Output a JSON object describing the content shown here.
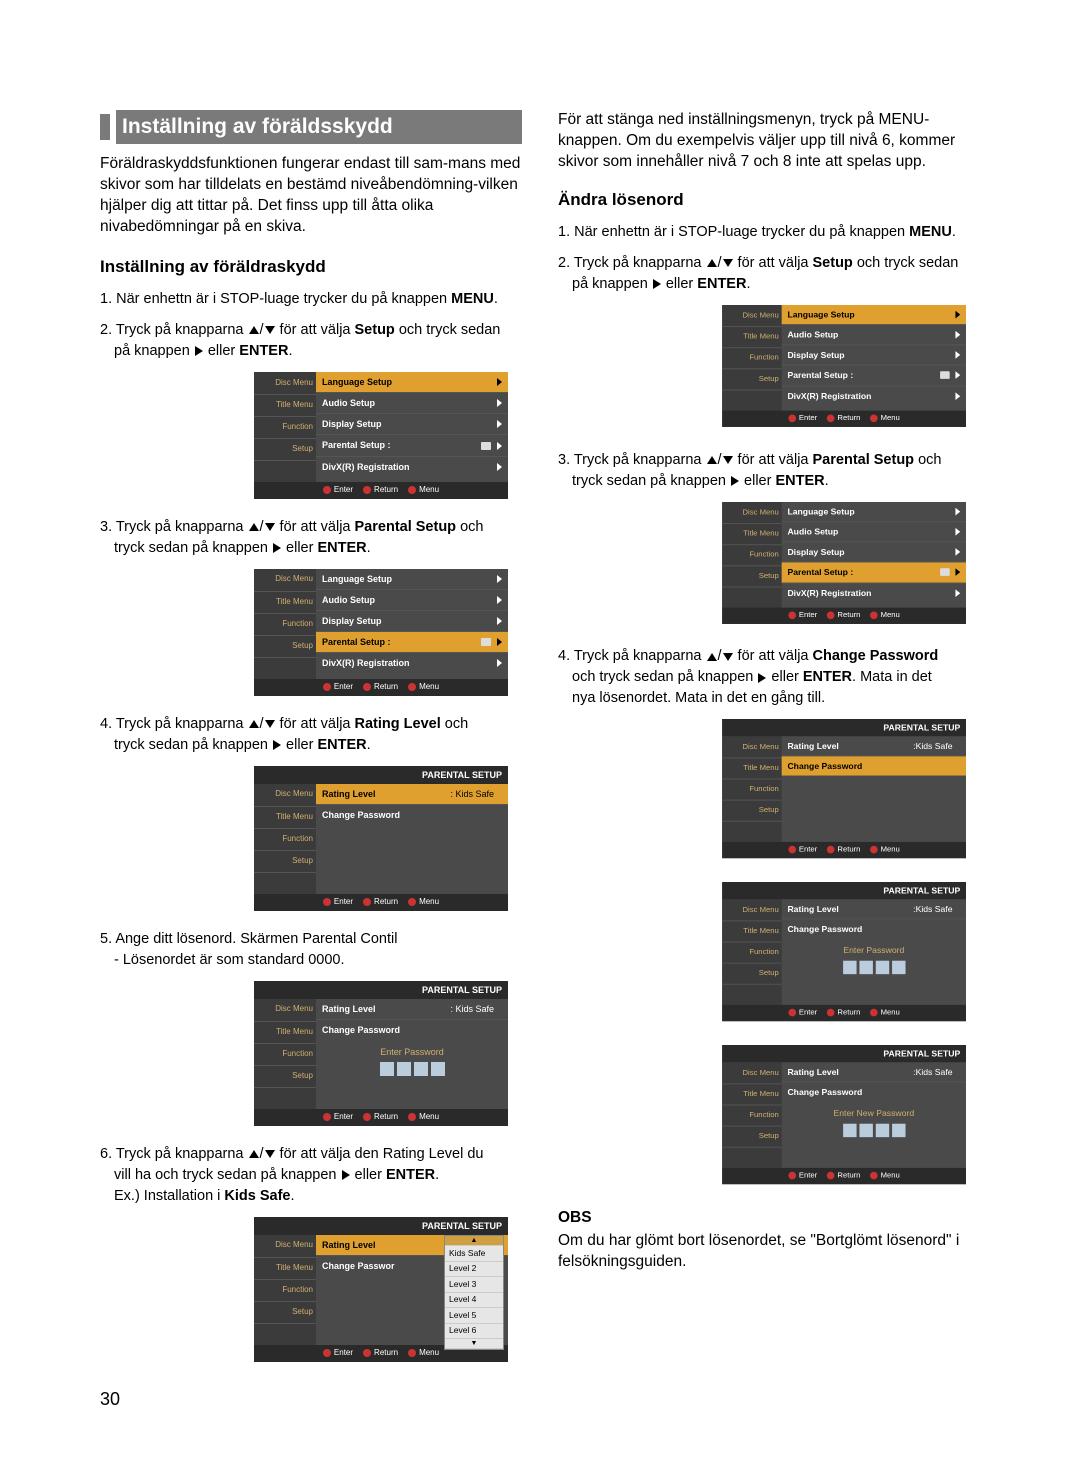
{
  "page_number": "30",
  "heading": "Inställning av föräldsskydd",
  "intro": "Föräldraskyddsfunktionen fungerar endast till sam-mans med skivor som har tilldelats en bestämd niveåbendömning-vilken hjälper dig att tittar på. Det finss upp till åtta olika nivabedömningar på en skiva.",
  "left": {
    "h2": "Inställning av föräldraskydd",
    "step1a": "1. När enhettn är i STOP-luage trycker du på knappen ",
    "step1b": "MENU",
    "step1c": ".",
    "step2a": "2. Tryck på knapparna ",
    "step2b": " för att välja ",
    "step2c": "Setup",
    "step2d": " och tryck sedan",
    "step2e": "på knappen ",
    "step2f": " eller ",
    "step2g": "ENTER",
    "step2h": ".",
    "step3a": "3. Tryck på knapparna ",
    "step3b": " för att välja ",
    "step3c": "Parental Setup",
    "step3d": " och",
    "step3e": "tryck sedan på knappen ",
    "step3f": " eller ",
    "step3g": "ENTER",
    "step3h": ".",
    "step4a": "4. Tryck på knapparna ",
    "step4b": " för att välja ",
    "step4c": "Rating Level",
    "step4d": "  och",
    "step4e": "tryck sedan på knappen ",
    "step4f": " eller ",
    "step4g": "ENTER",
    "step4h": ".",
    "step5a": "5. Ange ditt lösenord. Skärmen Parental Contil",
    "step5b": "- Lösenordet är som standard 0000.",
    "step6a": "6. Tryck på knapparna ",
    "step6b": " för att välja den Rating Level du",
    "step6c": "vill ha och tryck sedan på knappen ",
    "step6d": " eller ",
    "step6e": "ENTER",
    "step6f": ".",
    "step6g": "Ex.) Installation i  ",
    "step6h": "Kids Safe",
    "step6i": "."
  },
  "right": {
    "top": "För att stänga ned inställningsmenyn, tryck på MENU-knappen. Om du exempelvis väljer upp till nivå 6, kommer skivor som innehåller nivå 7 och 8 inte att spelas upp.",
    "h2": "Ändra lösenord",
    "step1a": "1. När enhettn är i STOP-luage trycker du på knappen ",
    "step1b": "MENU",
    "step1c": ".",
    "step2a": "2. Tryck på knapparna ",
    "step2b": " för att välja ",
    "step2c": "Setup",
    "step2d": " och tryck sedan",
    "step2e": "på knappen ",
    "step2f": " eller ",
    "step2g": "ENTER",
    "step2h": ".",
    "step3a": "3. Tryck på knapparna ",
    "step3b": " för att välja ",
    "step3c": "Parental Setup",
    "step3d": " och",
    "step3e": "tryck sedan på knappen ",
    "step3f": " eller ",
    "step3g": "ENTER",
    "step3h": ".",
    "step4a": "4. Tryck på knapparna ",
    "step4b": " för att välja ",
    "step4c": "Change Password",
    "step4d": "och tryck sedan på knappen ",
    "step4e": " eller ",
    "step4f": "ENTER",
    "step4g": ". Mata in det",
    "step4h": "nya lösenordet. Mata in det en gång till.",
    "note_h": "OBS",
    "note": "Om du har glömt bort lösenordet, se \"Bortglömt lösenord\" i felsökningsguiden."
  },
  "osd": {
    "sidebar": [
      "Disc Menu",
      "Title Menu",
      "Function",
      "Setup",
      ""
    ],
    "menu": {
      "lang": "Language Setup",
      "audio": "Audio Setup",
      "display": "Display Setup",
      "parental": "Parental Setup :",
      "divx": "DivX(R) Registration"
    },
    "parental_hdr": "PARENTAL  SETUP",
    "rating": "Rating Level",
    "kids": ": Kids Safe",
    "kids2": ":Kids Safe",
    "change": "Change Password",
    "changesel": "Change Passwor",
    "enterpw": "Enter Password",
    "enternew": "Enter New Password",
    "footer": {
      "enter": "Enter",
      "return": "Return",
      "menu": "Menu"
    },
    "levels": [
      "Kids Safe",
      "Level 2",
      "Level 3",
      "Level 4",
      "Level 5",
      "Level 6"
    ]
  }
}
